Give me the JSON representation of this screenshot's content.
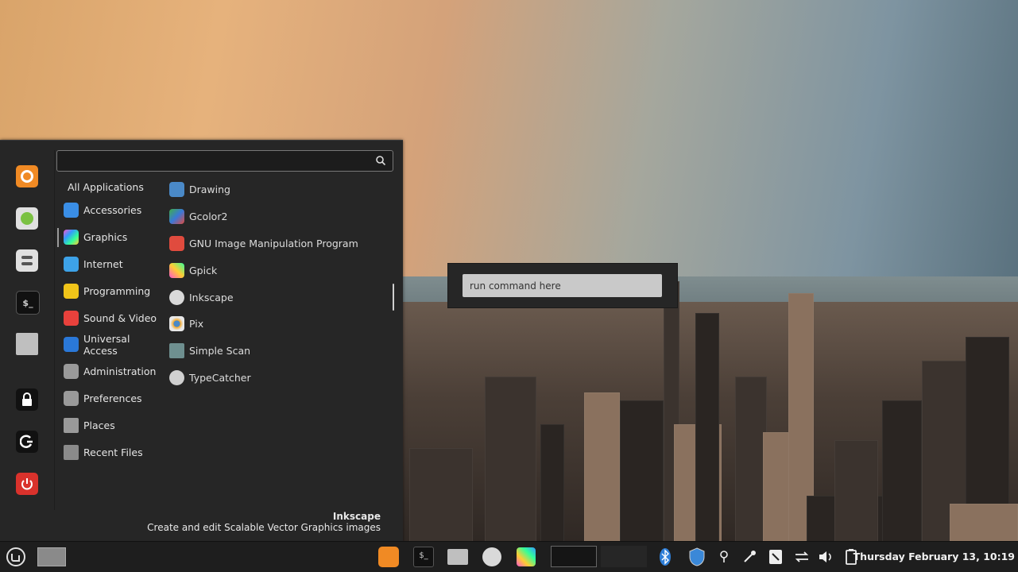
{
  "menu": {
    "search": {
      "value": "",
      "placeholder": ""
    },
    "favorites": [
      "firefox-icon",
      "software-center-icon",
      "settings-icon",
      "terminal-icon",
      "files-icon"
    ],
    "session": [
      "lock-icon",
      "logout-icon",
      "power-icon"
    ],
    "categories": [
      {
        "label": "All Applications"
      },
      {
        "label": "Accessories",
        "color": "#3a8ee6"
      },
      {
        "label": "Graphics",
        "color": "#c04bd6"
      },
      {
        "label": "Internet",
        "color": "#3da2e8"
      },
      {
        "label": "Programming",
        "color": "#f0c419"
      },
      {
        "label": "Sound & Video",
        "color": "#e8413c"
      },
      {
        "label": "Universal Access",
        "color": "#2a78d8"
      },
      {
        "label": "Administration",
        "color": "#9a9a9a"
      },
      {
        "label": "Preferences",
        "color": "#9a9a9a"
      },
      {
        "label": "Places",
        "color": "#9a9a9a"
      },
      {
        "label": "Recent Files",
        "color": "#8a8a8a"
      }
    ],
    "apps": [
      {
        "label": "Drawing",
        "color": "#4a89c7"
      },
      {
        "label": "Gcolor2",
        "color": "#3fae49"
      },
      {
        "label": "GNU Image Manipulation Program",
        "color": "#e04b3e"
      },
      {
        "label": "Gpick",
        "color": "#e9a23b"
      },
      {
        "label": "Inkscape",
        "color": "#d9d9d9"
      },
      {
        "label": "Pix",
        "color": "#e8e8e8"
      },
      {
        "label": "Simple Scan",
        "color": "#6e8f8f"
      },
      {
        "label": "TypeCatcher",
        "color": "#d0d0d0"
      }
    ],
    "description": {
      "title": "Inkscape",
      "text": "Create and edit Scalable Vector Graphics images"
    }
  },
  "run_dialog": {
    "value": "run command here"
  },
  "panel": {
    "clock": "Thursday February 13, 10:19"
  }
}
